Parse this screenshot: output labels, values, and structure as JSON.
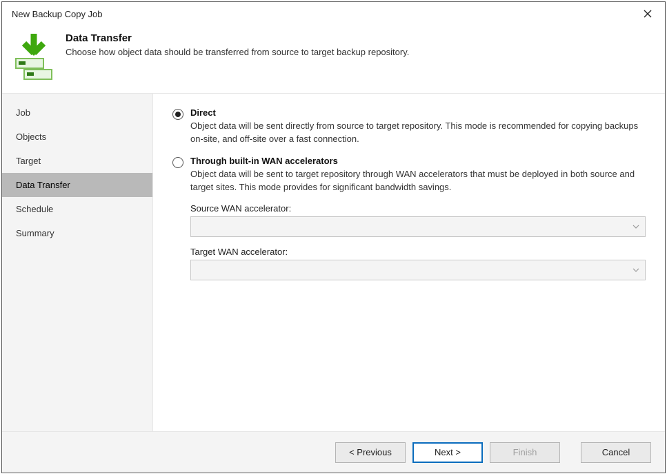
{
  "window": {
    "title": "New Backup Copy Job"
  },
  "header": {
    "title": "Data Transfer",
    "subtitle": "Choose how object data should be transferred from source to target backup repository."
  },
  "sidebar": {
    "items": [
      {
        "label": "Job",
        "active": false
      },
      {
        "label": "Objects",
        "active": false
      },
      {
        "label": "Target",
        "active": false
      },
      {
        "label": "Data Transfer",
        "active": true
      },
      {
        "label": "Schedule",
        "active": false
      },
      {
        "label": "Summary",
        "active": false
      }
    ]
  },
  "options": {
    "direct": {
      "title": "Direct",
      "desc": "Object data will be sent directly from source to target repository. This mode is recommended for copying backups on-site, and off-site over a fast connection.",
      "selected": true
    },
    "wan": {
      "title": "Through built-in WAN accelerators",
      "desc": "Object data will be sent to target repository through WAN accelerators that must be deployed in both source and target sites. This mode provides for significant bandwidth savings.",
      "selected": false
    }
  },
  "fields": {
    "source_label": "Source WAN accelerator:",
    "source_value": "",
    "target_label": "Target WAN accelerator:",
    "target_value": ""
  },
  "footer": {
    "previous": "< Previous",
    "next": "Next >",
    "finish": "Finish",
    "cancel": "Cancel"
  }
}
